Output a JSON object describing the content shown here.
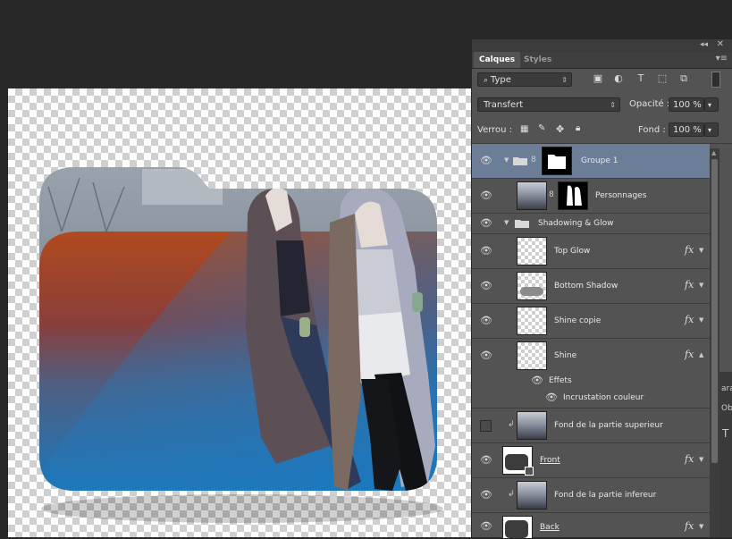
{
  "panel": {
    "tabs": [
      {
        "label": "Calques"
      },
      {
        "label": "Styles"
      }
    ],
    "filter_type": "Type",
    "blend_mode": "Transfert",
    "opacity_label": "Opacité :",
    "opacity_value": "100 %",
    "lock_label": "Verrou :",
    "fill_label": "Fond :",
    "fill_value": "100 %"
  },
  "layers": [
    {
      "name": "Groupe 1"
    },
    {
      "name": "Personnages"
    },
    {
      "name": "Shadowing & Glow"
    },
    {
      "name": "Top Glow",
      "fx": "fx"
    },
    {
      "name": "Bottom Shadow",
      "fx": "fx"
    },
    {
      "name": "Shine copie",
      "fx": "fx"
    },
    {
      "name": "Shine",
      "fx": "fx"
    },
    {
      "name": "Effets"
    },
    {
      "name": "Incrustation couleur"
    },
    {
      "name": "Fond de la partie superieur"
    },
    {
      "name": "Front",
      "fx": "fx"
    },
    {
      "name": "Fond de la partie infereur"
    },
    {
      "name": "Back",
      "fx": "fx"
    }
  ],
  "edge_glyphs": {
    "a": "ara",
    "b": "Ob",
    "c": "T"
  },
  "colors": {
    "selected_row": "#6b7d97",
    "panel_bg": "#535353",
    "workspace": "#282828"
  }
}
